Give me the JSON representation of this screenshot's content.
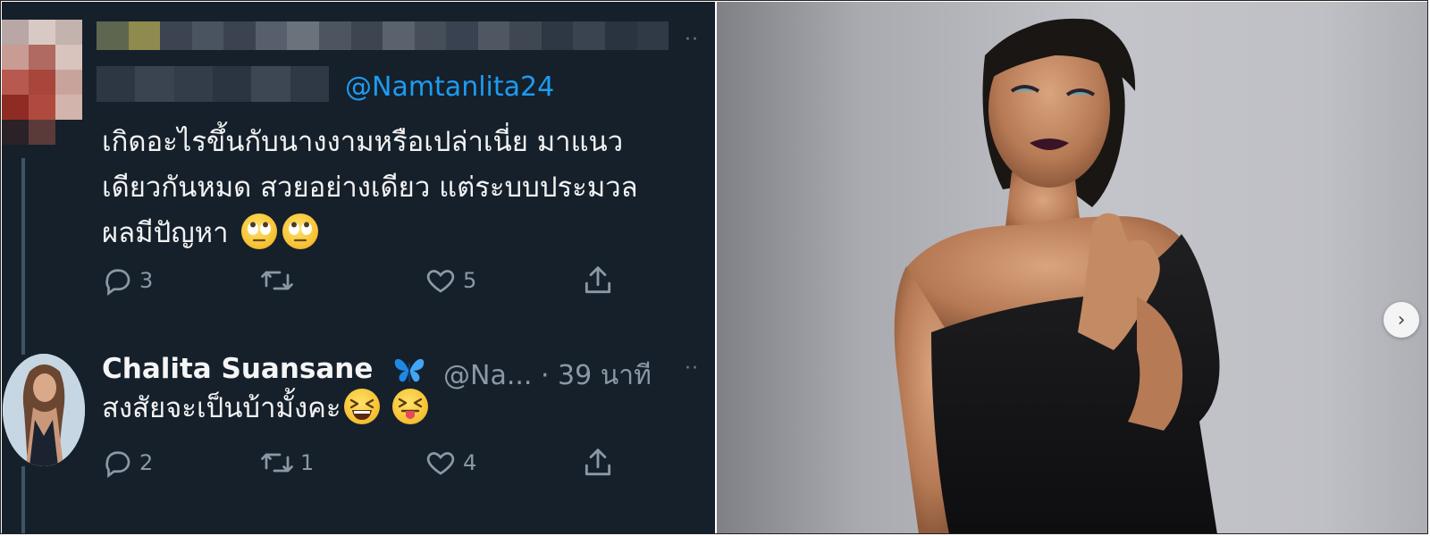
{
  "tweet": {
    "mention": "@Namtanlita24",
    "text_lines": [
      "เกิดอะไรขึ้นกับนางงามหรือเปล่าเนี่ย มาแนว",
      "เดียวกันหมด สวยอย่างเดียว แต่ระบบประมวล",
      "ผลมีปัญหา"
    ],
    "emojis": [
      "face-with-rolling-eyes-emoji",
      "face-with-rolling-eyes-emoji"
    ],
    "actions": {
      "reply_count": "3",
      "retweet_count": "",
      "like_count": "5"
    }
  },
  "reply": {
    "name": "Chalita Suansane",
    "badge_icon": "blue-butterfly-emoji",
    "handle_time": "@Na... · 39 นาที",
    "text": "สงสัยจะเป็นบ้ามั้งคะ",
    "emojis": [
      "grinning-squinting-face-emoji",
      "squinting-face-with-tongue-emoji"
    ],
    "actions": {
      "reply_count": "2",
      "retweet_count": "1",
      "like_count": "4"
    }
  },
  "photo": {
    "next_arrow_icon": "chevron-right-icon"
  },
  "colors": {
    "tweet_bg": "#15202b",
    "link_blue": "#1d9bf0",
    "muted_gray": "#8b98a5",
    "photo_bg": "#bfc0c6"
  }
}
